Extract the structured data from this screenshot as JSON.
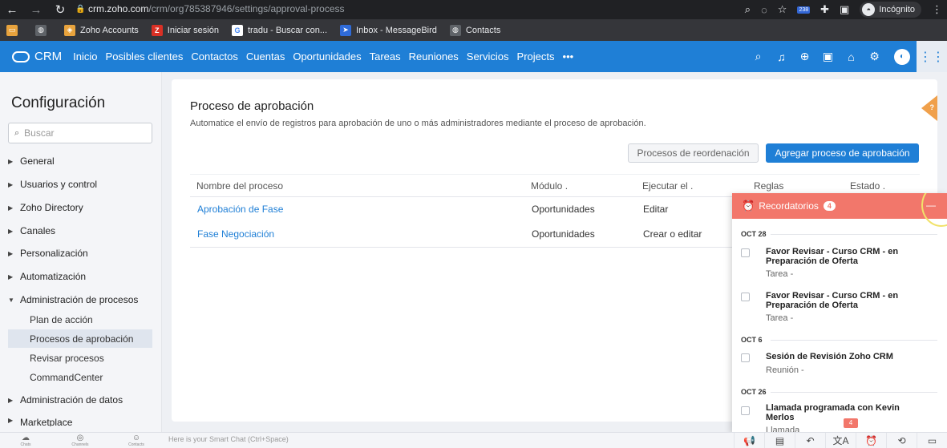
{
  "browser": {
    "url_host": "crm.zoho.com",
    "url_path": "/crm/org785387946/settings/approval-process",
    "profile_label": "Incógnito",
    "ext_badge": "238",
    "bookmarks": [
      {
        "label": "Zoho Accounts",
        "color": "#e8a33d"
      },
      {
        "label": "Iniciar sesión",
        "color": "#d93025"
      },
      {
        "label": "tradu - Buscar con...",
        "color": "#4285f4"
      },
      {
        "label": "Inbox - MessageBird",
        "color": "#2f6bd8"
      },
      {
        "label": "Contacts",
        "color": "#9aa0a6"
      }
    ]
  },
  "crm_nav": {
    "logo": "CRM",
    "links": [
      "Inicio",
      "Posibles clientes",
      "Contactos",
      "Cuentas",
      "Oportunidades",
      "Tareas",
      "Reuniones",
      "Servicios",
      "Projects",
      "•••"
    ],
    "accent": "#1f7fd6"
  },
  "sidebar": {
    "title": "Configuración",
    "search_placeholder": "Buscar",
    "sections": [
      "General",
      "Usuarios y control",
      "Zoho Directory",
      "Canales",
      "Personalización",
      "Automatización",
      "Administración de procesos"
    ],
    "sub_items": [
      "Plan de acción",
      "Procesos de aprobación",
      "Revisar procesos",
      "CommandCenter"
    ],
    "after_sections": [
      "Administración de datos",
      "Marketplace"
    ]
  },
  "main": {
    "title": "Proceso de aprobación",
    "description": "Automatice el envío de registros para aprobación de uno o más administradores mediante el proceso de aprobación.",
    "btn_reorder": "Procesos de reordenación",
    "btn_add": "Agregar proceso de aprobación",
    "columns": [
      "Nombre del proceso",
      "Módulo",
      "Ejecutar el",
      "Reglas",
      "Estado"
    ],
    "rows": [
      {
        "name": "Aprobación de Fase",
        "module": "Oportunidades",
        "execute": "Editar"
      },
      {
        "name": "Fase Negociación",
        "module": "Oportunidades",
        "execute": "Crear o editar"
      }
    ]
  },
  "reminders": {
    "title": "Recordatorios",
    "count": "4",
    "groups": [
      {
        "date": "OCT 28",
        "items": [
          {
            "title": "Favor Revisar - Curso CRM - en Preparación de Oferta",
            "type": "Tarea -"
          },
          {
            "title": "Favor Revisar - Curso CRM - en Preparación de Oferta",
            "type": "Tarea -"
          }
        ]
      },
      {
        "date": "OCT 6",
        "items": [
          {
            "title": "Sesión de Revisión Zoho CRM",
            "type": "Reunión -"
          }
        ]
      },
      {
        "date": "OCT 26",
        "items": [
          {
            "title": "Llamada programada con Kevin Merlos",
            "type": "Llamada"
          }
        ]
      }
    ]
  },
  "bottom_bar": {
    "chat_placeholder": "Here is your Smart Chat (Ctrl+Space)",
    "left_labels": [
      "Chats",
      "Channels",
      "Contacts"
    ],
    "notif_count": "4"
  }
}
